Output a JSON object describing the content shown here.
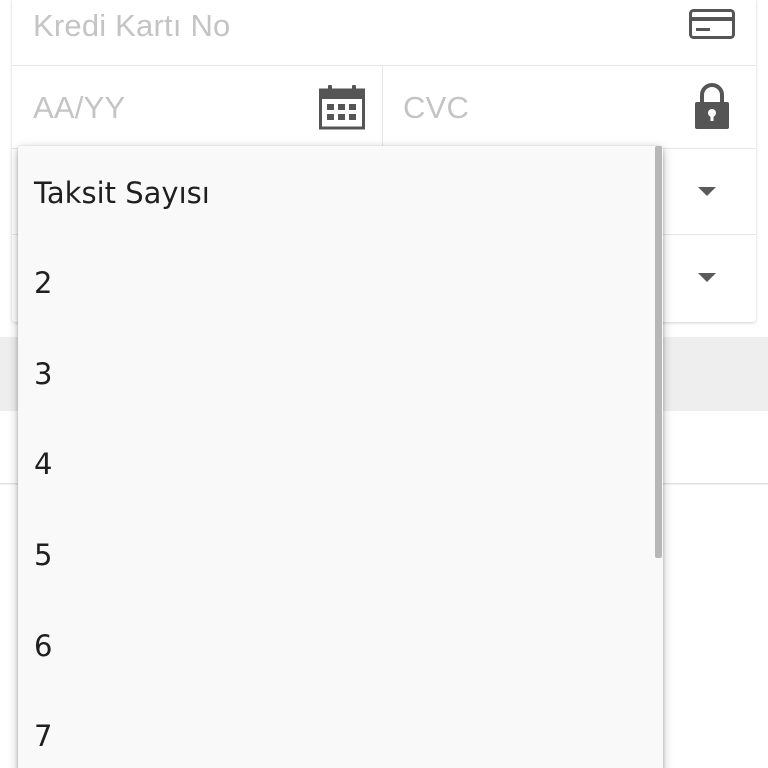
{
  "form": {
    "card_number_placeholder": "Kredi Kartı No",
    "expiry_placeholder": "AA/YY",
    "cvc_placeholder": "CVC"
  },
  "icons": {
    "card": "credit-card-icon",
    "calendar": "calendar-icon",
    "lock": "lock-icon",
    "caret": "caret-down-icon"
  },
  "dropdown": {
    "options": [
      {
        "label": "Taksit Sayısı"
      },
      {
        "label": "2"
      },
      {
        "label": "3"
      },
      {
        "label": "4"
      },
      {
        "label": "5"
      },
      {
        "label": "6"
      },
      {
        "label": "7"
      }
    ]
  },
  "colors": {
    "placeholder": "#c4c4c4",
    "icon": "#555555",
    "menu_bg": "#f9f9f9"
  }
}
